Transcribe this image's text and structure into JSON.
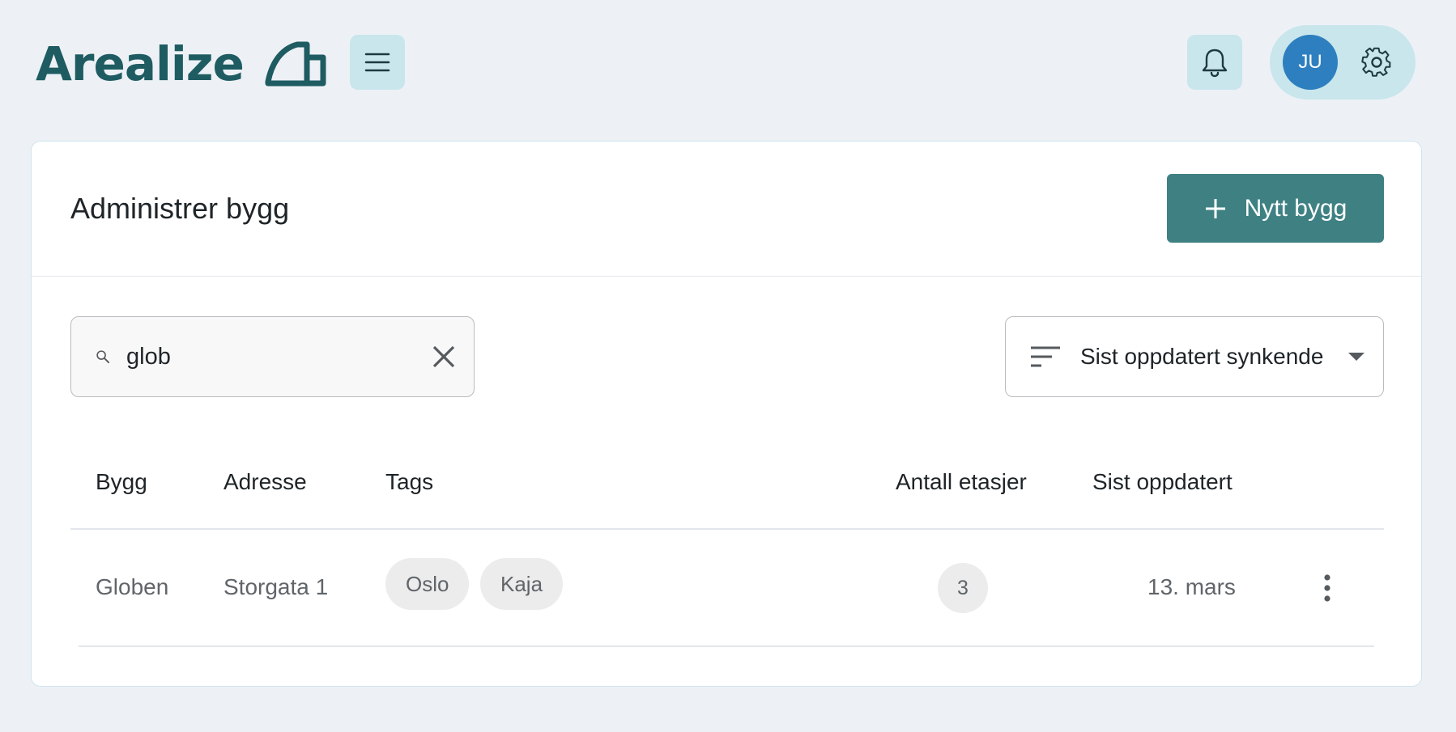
{
  "app": {
    "brand": "Arealize",
    "user_initials": "JU",
    "colors": {
      "brand": "#1e5c62",
      "accent": "#3f8183",
      "avatar": "#2e7fbf",
      "chip": "#c8e6ec",
      "background": "#edf1f6"
    }
  },
  "icons": {
    "menu": "hamburger-menu-icon",
    "bell": "bell-icon",
    "gear": "gear-icon",
    "plus": "plus-icon",
    "search": "search-icon",
    "clear": "close-icon",
    "sort": "sort-lines-icon",
    "dropdown": "caret-down-icon",
    "more": "vertical-dots-icon"
  },
  "page": {
    "title": "Administrer bygg",
    "new_button_label": "Nytt bygg"
  },
  "search": {
    "value": "glob"
  },
  "sort": {
    "selected": "Sist oppdatert synkende"
  },
  "table": {
    "columns": [
      "Bygg",
      "Adresse",
      "Tags",
      "Antall etasjer",
      "Sist oppdatert"
    ],
    "rows": [
      {
        "name": "Globen",
        "address": "Storgata 1",
        "tags": [
          "Oslo",
          "Kaja"
        ],
        "floors": "3",
        "updated": "13. mars"
      }
    ]
  }
}
